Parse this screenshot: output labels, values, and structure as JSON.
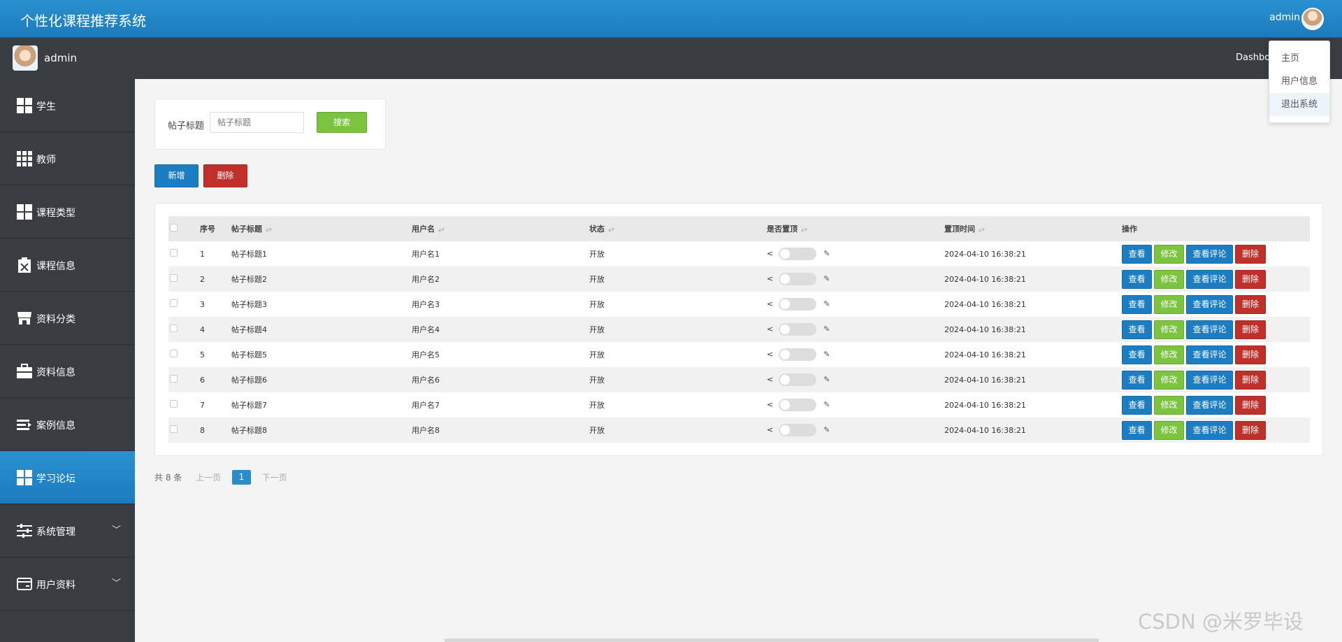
{
  "app": {
    "title": "个性化课程推荐系统",
    "user": "admin"
  },
  "subbar": {
    "name": "admin",
    "dashboard": "Dashboa"
  },
  "dropdown": {
    "items": [
      "主页",
      "用户信息",
      "退出系统"
    ]
  },
  "sidebar": {
    "items": [
      {
        "label": "学生",
        "icon": "grid-icon"
      },
      {
        "label": "教师",
        "icon": "grid-9-icon"
      },
      {
        "label": "课程类型",
        "icon": "grid-icon"
      },
      {
        "label": "课程信息",
        "icon": "clipboard-x-icon"
      },
      {
        "label": "资料分类",
        "icon": "store-icon"
      },
      {
        "label": "资料信息",
        "icon": "briefcase-icon"
      },
      {
        "label": "案例信息",
        "icon": "list-icon"
      },
      {
        "label": "学习论坛",
        "icon": "grid-icon"
      },
      {
        "label": "系统管理",
        "icon": "sliders-icon"
      },
      {
        "label": "用户资料",
        "icon": "card-icon"
      }
    ],
    "active": "学习论坛"
  },
  "search": {
    "label": "帖子标题",
    "placeholder": "帖子标题",
    "button": "搜索"
  },
  "actions": {
    "add": "新增",
    "delete": "删除"
  },
  "table": {
    "headers": [
      "序号",
      "帖子标题",
      "用户名",
      "状态",
      "是否置顶",
      "置顶时间",
      "操作"
    ],
    "rows": [
      {
        "no": "1",
        "title": "帖子标题1",
        "user": "用户名1",
        "status": "开放",
        "time": "2024-04-10 16:38:21"
      },
      {
        "no": "2",
        "title": "帖子标题2",
        "user": "用户名2",
        "status": "开放",
        "time": "2024-04-10 16:38:21"
      },
      {
        "no": "3",
        "title": "帖子标题3",
        "user": "用户名3",
        "status": "开放",
        "time": "2024-04-10 16:38:21"
      },
      {
        "no": "4",
        "title": "帖子标题4",
        "user": "用户名4",
        "status": "开放",
        "time": "2024-04-10 16:38:21"
      },
      {
        "no": "5",
        "title": "帖子标题5",
        "user": "用户名5",
        "status": "开放",
        "time": "2024-04-10 16:38:21"
      },
      {
        "no": "6",
        "title": "帖子标题6",
        "user": "用户名6",
        "status": "开放",
        "time": "2024-04-10 16:38:21"
      },
      {
        "no": "7",
        "title": "帖子标题7",
        "user": "用户名7",
        "status": "开放",
        "time": "2024-04-10 16:38:21"
      },
      {
        "no": "8",
        "title": "帖子标题8",
        "user": "用户名8",
        "status": "开放",
        "time": "2024-04-10 16:38:21"
      }
    ],
    "row_actions": [
      "查看",
      "修改",
      "查看评论",
      "删除"
    ]
  },
  "pager": {
    "total": "共 8 条",
    "prev": "上一页",
    "current": "1",
    "next": "下一页"
  },
  "watermark": "CSDN @米罗毕设",
  "colors": {
    "primary": "#1c7dc2",
    "success": "#7cc440",
    "danger": "#c0302a",
    "sidebar": "#393d42"
  }
}
